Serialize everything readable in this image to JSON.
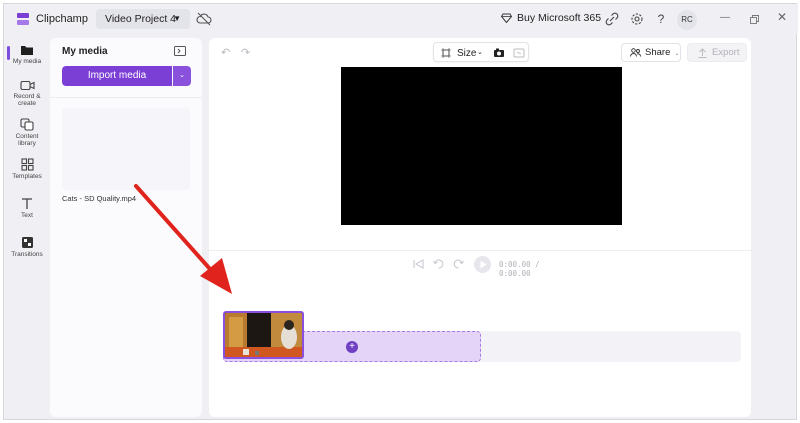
{
  "titlebar": {
    "app_name": "Clipchamp",
    "project_name": "Video Project 4",
    "project_caret": "▼",
    "buy_label": "Buy Microsoft 365",
    "help_label": "?",
    "avatar_initials": "RC"
  },
  "rail": {
    "items": [
      {
        "label": "My media",
        "icon": "folder-icon"
      },
      {
        "label": "Record &\ncreate",
        "icon": "camera-icon"
      },
      {
        "label": "Content\nlibrary",
        "icon": "library-icon"
      },
      {
        "label": "Templates",
        "icon": "templates-icon"
      },
      {
        "label": "Text",
        "icon": "text-icon"
      },
      {
        "label": "Transitions",
        "icon": "transitions-icon"
      }
    ],
    "active_index": 0
  },
  "media_panel": {
    "title": "My media",
    "import_label": "Import media",
    "file_name": "Cats - SD Quality.mp4"
  },
  "editor": {
    "size_label": "Size",
    "share_label": "Share",
    "export_label": "Export",
    "current_time": "0:00.00",
    "total_time": "/ 0:00.00",
    "add_label": "+"
  },
  "colors": {
    "accent": "#7c3fd6",
    "annotation_arrow": "#e0231c"
  }
}
